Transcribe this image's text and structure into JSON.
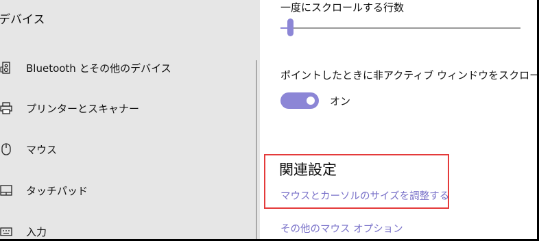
{
  "sidebar": {
    "title": "デバイス",
    "items": [
      {
        "label": "Bluetooth とその他のデバイス",
        "icon": "bluetooth-devices-icon"
      },
      {
        "label": "プリンターとスキャナー",
        "icon": "printer-icon"
      },
      {
        "label": "マウス",
        "icon": "mouse-icon"
      },
      {
        "label": "タッチパッド",
        "icon": "touchpad-icon"
      },
      {
        "label": "入力",
        "icon": "keyboard-icon"
      }
    ]
  },
  "main": {
    "scroll_lines": {
      "label": "一度にスクロールする行数",
      "level": 0.03
    },
    "inactive_scroll": {
      "label": "ポイントしたときに非アクティブ ウィンドウをスクロールする",
      "state": "オン",
      "on": true
    },
    "related": {
      "title": "関連設定",
      "link_pointer_size": "マウスとカーソルのサイズを調整する",
      "link_other_mouse": "その他のマウス オプション"
    }
  },
  "colors": {
    "accent": "#8c86d6",
    "link": "#7a72c9",
    "highlight_border": "#e43a3a",
    "sidebar_bg": "#e6e6e6"
  }
}
